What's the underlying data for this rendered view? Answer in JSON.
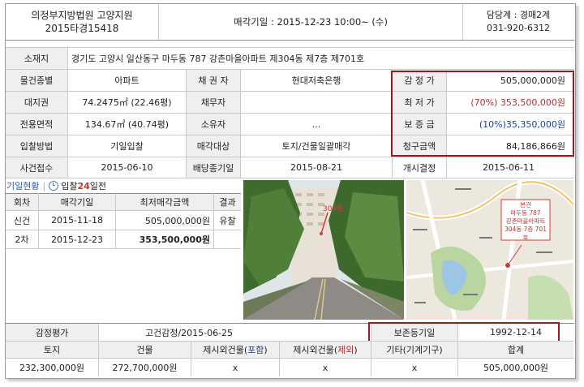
{
  "header": {
    "court": "의정부지방법원 고양지원",
    "case_no": "2015타경15418",
    "sale_date": "매각기일 : 2015-12-23   10:00~ (수)",
    "dept": "담당계 : 경매2계",
    "phone": "031-920-6312"
  },
  "location": {
    "label": "소재지",
    "value": "경기도 고양시 일산동구 마두동 787 강촌마을아파트 제304동 제7층 제701호"
  },
  "rows": [
    {
      "l1": "물건종별",
      "v1": "아파트",
      "l2": "채 권 자",
      "v2": "현대저축은행",
      "l3": "감 정 가",
      "v3": "505,000,000원"
    },
    {
      "l1": "대지권",
      "v1": "74.2475㎡ (22.46평)",
      "l2": "채무자",
      "v2": "",
      "l3": "최 저 가",
      "v3": "(70%) 353,500,000원"
    },
    {
      "l1": "전용면적",
      "v1": "134.67㎡ (40.74평)",
      "l2": "소유자",
      "v2": "...",
      "l3": "보 증 금",
      "v3": "(10%)35,350,000원"
    },
    {
      "l1": "입찰방법",
      "v1": "기일입찰",
      "l2": "매각대상",
      "v2": "토지/건물일괄매각",
      "l3": "청구금액",
      "v3": "84,186,866원"
    },
    {
      "l1": "사건접수",
      "v1": "2015-06-10",
      "l2": "배당종기일",
      "v2": "2015-08-21",
      "l3": "개시결정",
      "v3": "2015-06-11"
    }
  ],
  "history": {
    "title": "기일현황",
    "bid_prefix": "입찰",
    "bid_days": "24",
    "bid_suffix": "일전",
    "columns": [
      "회차",
      "매각기일",
      "최저매각금액",
      "결과"
    ],
    "items": [
      {
        "round": "신건",
        "date": "2015-11-18",
        "price": "505,000,000원",
        "result": "유찰"
      },
      {
        "round": "2차",
        "date": "2015-12-23",
        "price": "353,500,000원",
        "result": ""
      }
    ]
  },
  "photo": {
    "caption": "304동"
  },
  "map": {
    "label_lines": [
      "본건",
      "마두동 787",
      "강촌마을아파트",
      "304동 7층 701호"
    ]
  },
  "appraisal": {
    "label": "감정평가",
    "value": "고건감정/2015-06-25",
    "reg_label": "보존등기일",
    "reg_value": "1992-12-14",
    "columns": [
      "토지",
      "건물",
      "제시외건물(포함)",
      "제시외건물(제외)",
      "기타(기계기구)",
      "합계"
    ],
    "values": [
      "232,300,000원",
      "272,700,000원",
      "x",
      "x",
      "x",
      "505,000,000원"
    ]
  },
  "colors": {
    "accent_red": "#9c1a1a",
    "label_bg": "#efefef",
    "link_blue": "#1f3f9a"
  }
}
